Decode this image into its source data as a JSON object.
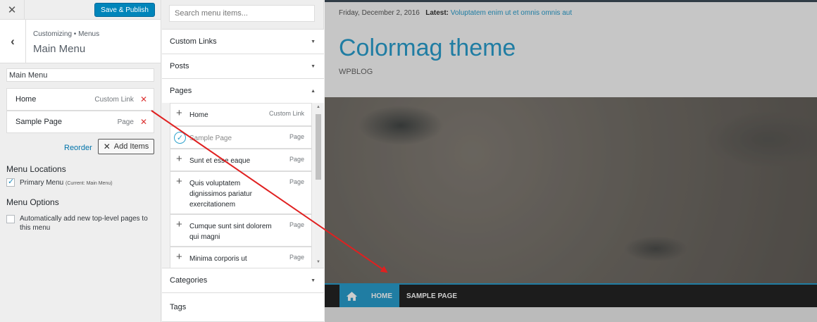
{
  "topbar": {
    "close_icon": "close-icon",
    "publish_label": "Save & Publish",
    "publish_color": "#0085ba"
  },
  "section": {
    "breadcrumb": "Customizing • Menus",
    "title": "Main Menu"
  },
  "menu": {
    "name_value": "Main Menu",
    "items": [
      {
        "title": "Home",
        "type": "Custom Link"
      },
      {
        "title": "Sample Page",
        "type": "Page"
      }
    ],
    "reorder_label": "Reorder",
    "add_items_label": "Add Items"
  },
  "locations": {
    "heading": "Menu Locations",
    "primary_label": "Primary Menu",
    "primary_note": "(Current: Main Menu)",
    "primary_checked": true
  },
  "options": {
    "heading": "Menu Options",
    "auto_add_label": "Automatically add new top-level pages to this menu",
    "auto_add_checked": false
  },
  "available": {
    "search_placeholder": "Search menu items...",
    "sections": [
      "Custom Links",
      "Posts",
      "Pages",
      "Categories",
      "Tags"
    ],
    "pages": [
      {
        "title": "Home",
        "type": "Custom Link",
        "added": false
      },
      {
        "title": "Sample Page",
        "type": "Page",
        "added": true
      },
      {
        "title": "Sunt et esse eaque",
        "type": "Page",
        "added": false
      },
      {
        "title": "Quis voluptatem dignissimos pariatur exercitationem",
        "type": "Page",
        "added": false
      },
      {
        "title": "Cumque sunt sint dolorem qui magni",
        "type": "Page",
        "added": false
      },
      {
        "title": "Minima corporis ut",
        "type": "Page",
        "added": false
      }
    ]
  },
  "preview": {
    "date": "Friday, December 2, 2016",
    "latest_label": "Latest:",
    "latest_link": "Voluptatem enim ut et omnis omnis aut",
    "site_title": "Colormag theme",
    "tagline": "WPBLOG",
    "nav": [
      "HOME",
      "SAMPLE PAGE"
    ],
    "accent_color": "#289dcc"
  },
  "annotation": {
    "arrow_color": "#e02020"
  }
}
